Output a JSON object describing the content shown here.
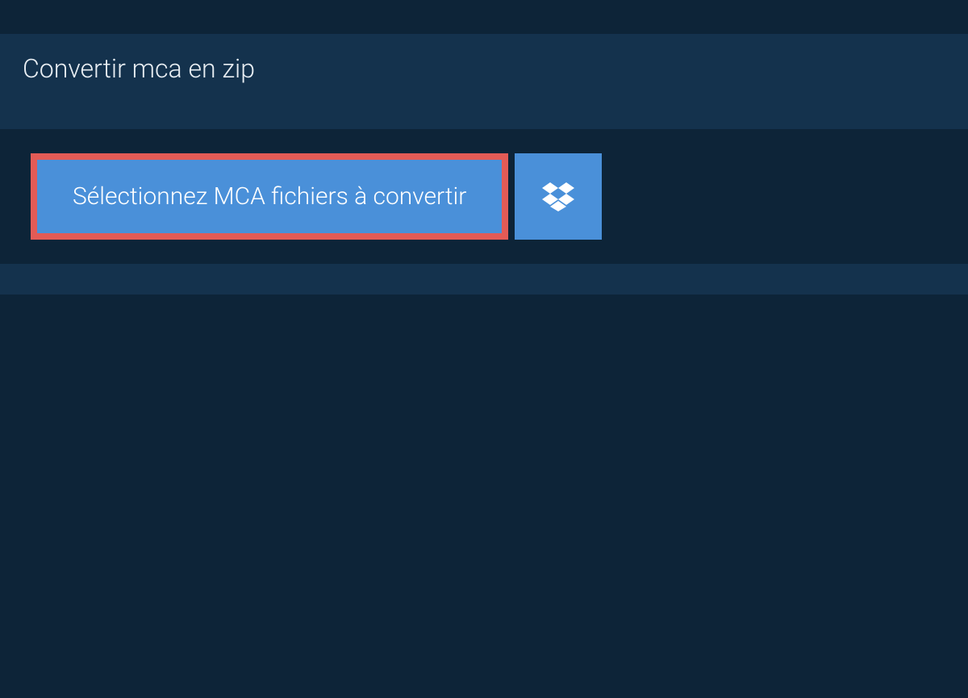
{
  "tab": {
    "title": "Convertir mca en zip"
  },
  "actions": {
    "select_files_label": "Sélectionnez MCA fichiers à convertir"
  },
  "colors": {
    "bg_dark": "#0d2438",
    "bg_panel": "#14324d",
    "button_blue": "#4a90d9",
    "highlight_red": "#e35b56",
    "text_light": "#e8eef3"
  }
}
